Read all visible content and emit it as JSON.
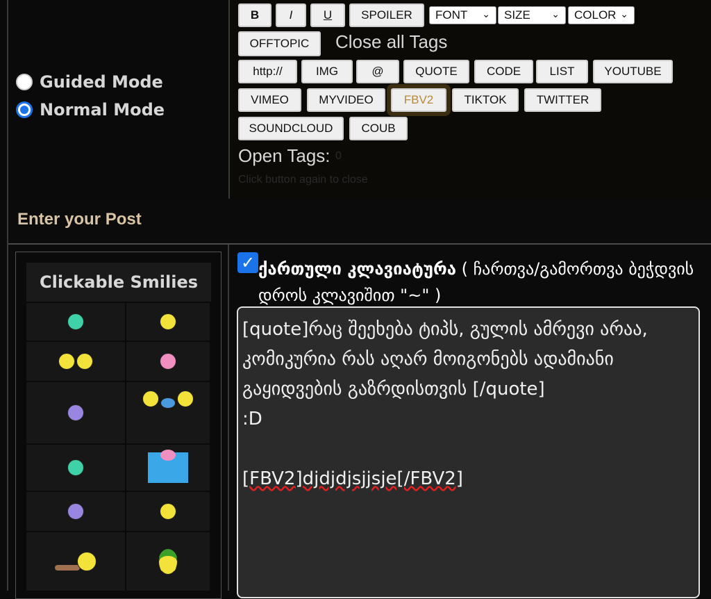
{
  "mode": {
    "guided_label": "Guided Mode",
    "normal_label": "Normal Mode",
    "selected": "Normal Mode"
  },
  "toolbar": {
    "row1": [
      "B",
      "I",
      "U",
      "SPOILER"
    ],
    "font_select": "FONT",
    "size_select": "SIZE",
    "color_select": "COLOR",
    "offtopic": "OFFTOPIC",
    "close_all": "Close all Tags",
    "row3": [
      "http://",
      "IMG",
      "@",
      "QUOTE",
      "CODE",
      "LIST",
      "YOUTUBE"
    ],
    "row4": [
      "VIMEO",
      "MYVIDEO",
      "FBV2",
      "TIKTOK",
      "TWITTER"
    ],
    "row5": [
      "SOUNDCLOUD",
      "COUB"
    ],
    "open_tags_label": "Open Tags:",
    "open_tags_value": "0",
    "hint": "Click button again to close"
  },
  "post": {
    "header": "Enter your Post",
    "smilies_title": "Clickable Smilies",
    "keyboard_checked": true,
    "keyboard_label_bold": "ქართული კლავიატურა",
    "keyboard_label_rest": " ( ჩართვა/გამორთვა ბეჭდვის დროს კლავიშით \"~\" )",
    "text_line1": "[quote]რაც შეეხება ტიპს, გულის ამრევი არაა, კომიკურია რას აღარ მოიგონებს ადამიანი გაყიდვების გაზრდისთვის [/quote]\n:D\n\n",
    "text_fbv2": "[FBV2]djdjdjsjjsje[/FBV2]"
  },
  "colors": {
    "accent": "#1a73e8",
    "header_text": "#d8c4a4",
    "panel": "#171717"
  }
}
